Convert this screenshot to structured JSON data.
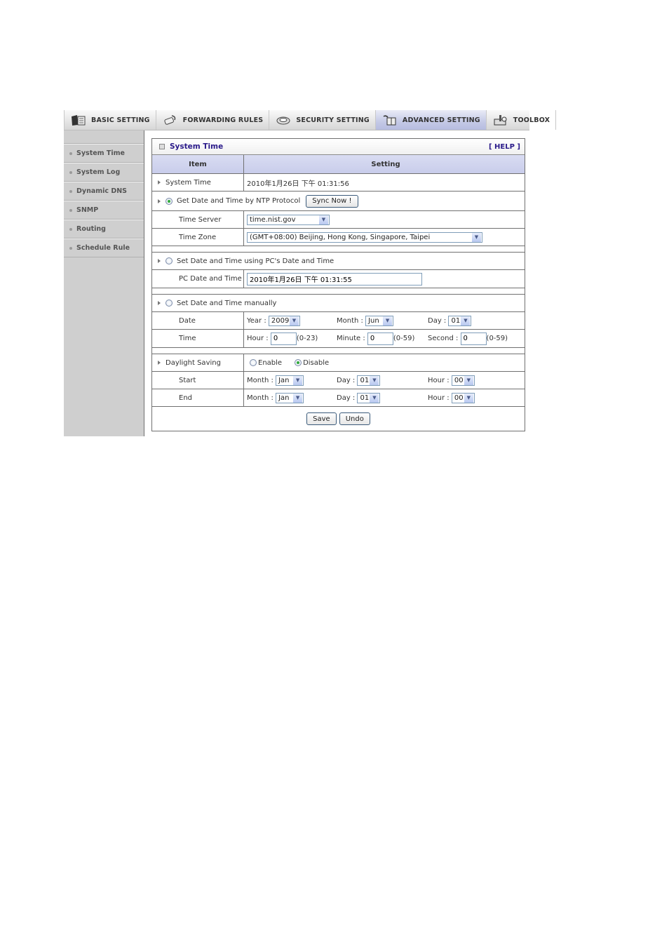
{
  "topnav": {
    "tabs": [
      {
        "label": "BASIC SETTING",
        "icon": "folder-icon",
        "active": false
      },
      {
        "label": "FORWARDING RULES",
        "icon": "forwarding-icon",
        "active": false
      },
      {
        "label": "SECURITY SETTING",
        "icon": "security-icon",
        "active": false
      },
      {
        "label": "ADVANCED SETTING",
        "icon": "advanced-icon",
        "active": true
      },
      {
        "label": "TOOLBOX",
        "icon": "toolbox-icon",
        "active": false
      }
    ]
  },
  "sidebar": {
    "items": [
      {
        "label": "System Time"
      },
      {
        "label": "System Log"
      },
      {
        "label": "Dynamic DNS"
      },
      {
        "label": "SNMP"
      },
      {
        "label": "Routing"
      },
      {
        "label": "Schedule Rule"
      }
    ]
  },
  "panel": {
    "title": "System Time",
    "help": "[ HELP ]",
    "col_item": "Item",
    "col_setting": "Setting",
    "system_time_label": "System Time",
    "system_time_value": "2010年1月26日 下午 01:31:56",
    "ntp": {
      "label": "Get Date and Time by NTP Protocol",
      "selected": true,
      "sync_button": "Sync Now !",
      "time_server_label": "Time Server",
      "time_server_value": "time.nist.gov",
      "time_zone_label": "Time Zone",
      "time_zone_value": "(GMT+08:00) Beijing, Hong Kong, Singapore, Taipei"
    },
    "pc": {
      "label": "Set Date and Time using PC's Date and Time",
      "selected": false,
      "pc_label": "PC Date and Time",
      "pc_value": "2010年1月26日 下午 01:31:55"
    },
    "manual": {
      "label": "Set Date and Time manually",
      "selected": false,
      "date_label": "Date",
      "year_label": "Year :",
      "year_value": "2009",
      "month_label": "Month :",
      "month_value": "Jun",
      "day_label": "Day :",
      "day_value": "01",
      "time_label": "Time",
      "hour_label": "Hour :",
      "hour_value": "0",
      "hour_range": "(0-23)",
      "minute_label": "Minute :",
      "minute_value": "0",
      "minute_range": "(0-59)",
      "second_label": "Second :",
      "second_value": "0",
      "second_range": "(0-59)"
    },
    "dst": {
      "label": "Daylight Saving",
      "enable_label": "Enable",
      "disable_label": "Disable",
      "enabled": false,
      "start_label": "Start",
      "end_label": "End",
      "month_label": "Month :",
      "day_label": "Day :",
      "hour_label": "Hour :",
      "start_month": "Jan",
      "start_day": "01",
      "start_hour": "00",
      "end_month": "Jan",
      "end_day": "01",
      "end_hour": "00"
    },
    "save_button": "Save",
    "undo_button": "Undo"
  }
}
